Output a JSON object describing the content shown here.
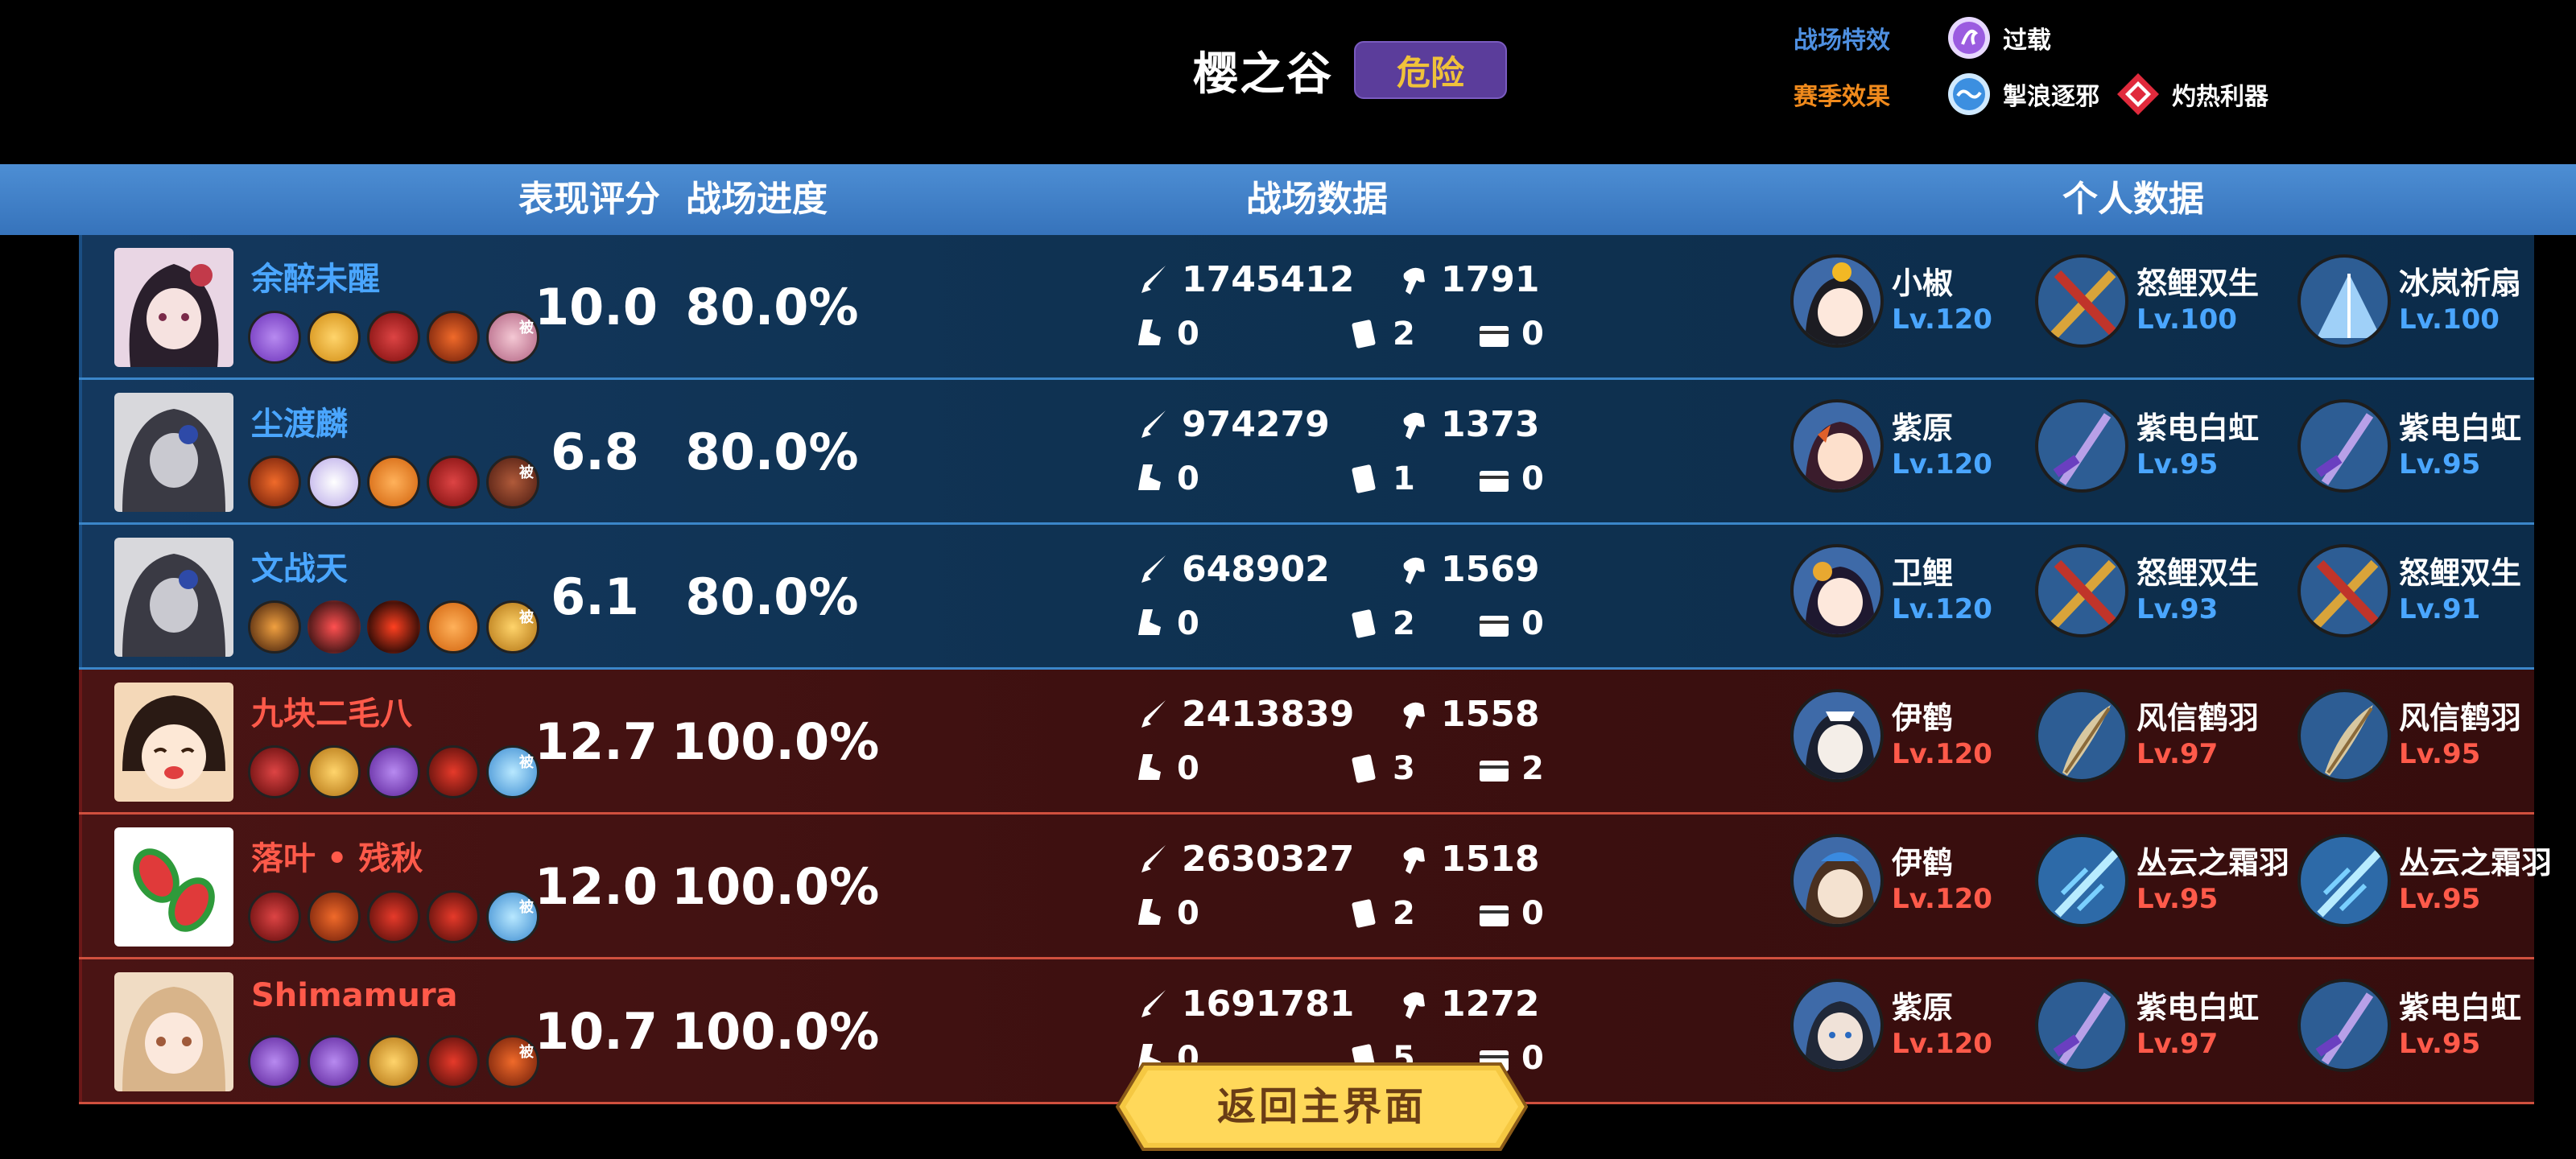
{
  "battlefield": {
    "map_name": "樱之谷",
    "danger_label": "危险"
  },
  "effects": {
    "battlefield_label": "战场特效",
    "battlefield_effect": "过载",
    "season_label": "赛季效果",
    "season_effect_1": "掣浪逐邪",
    "season_effect_2": "灼热利器",
    "colors": {
      "battlefield_label": "#4e8fe0",
      "season_label": "#f08a1c"
    }
  },
  "headers": {
    "score": "表现评分",
    "progress": "战场进度",
    "battle_data": "战场数据",
    "personal_data": "个人数据"
  },
  "team_colors": {
    "blue": "#4aa6ff",
    "red": "#ff5a4a"
  },
  "players": [
    {
      "name": "余醉未醒",
      "team": "blue",
      "score": "10.0",
      "progress": "80.0%",
      "damage": "1745412",
      "heal": "1791",
      "kills": "0",
      "cards": "2",
      "chests": "0",
      "hero": {
        "name": "小椒",
        "level": "Lv.120"
      },
      "weapon1": {
        "name": "怒鲤双生",
        "level": "Lv.100"
      },
      "weapon2": {
        "name": "冰岚祈扇",
        "level": "Lv.100"
      },
      "skill_mark": "被"
    },
    {
      "name": "尘渡麟",
      "team": "blue",
      "score": "6.8",
      "progress": "80.0%",
      "damage": "974279",
      "heal": "1373",
      "kills": "0",
      "cards": "1",
      "chests": "0",
      "hero": {
        "name": "紫原",
        "level": "Lv.120"
      },
      "weapon1": {
        "name": "紫电白虹",
        "level": "Lv.95"
      },
      "weapon2": {
        "name": "紫电白虹",
        "level": "Lv.95"
      },
      "skill_mark": "被"
    },
    {
      "name": "文战天",
      "team": "blue",
      "score": "6.1",
      "progress": "80.0%",
      "damage": "648902",
      "heal": "1569",
      "kills": "0",
      "cards": "2",
      "chests": "0",
      "hero": {
        "name": "卫鲤",
        "level": "Lv.120"
      },
      "weapon1": {
        "name": "怒鲤双生",
        "level": "Lv.93"
      },
      "weapon2": {
        "name": "怒鲤双生",
        "level": "Lv.91"
      },
      "skill_mark": "被"
    },
    {
      "name": "九块二毛八",
      "team": "red",
      "score": "12.7",
      "progress": "100.0%",
      "damage": "2413839",
      "heal": "1558",
      "kills": "0",
      "cards": "3",
      "chests": "2",
      "hero": {
        "name": "伊鹤",
        "level": "Lv.120"
      },
      "weapon1": {
        "name": "风信鹤羽",
        "level": "Lv.97"
      },
      "weapon2": {
        "name": "风信鹤羽",
        "level": "Lv.95"
      },
      "skill_mark": "被"
    },
    {
      "name": "落叶 • 残秋",
      "team": "red",
      "score": "12.0",
      "progress": "100.0%",
      "damage": "2630327",
      "heal": "1518",
      "kills": "0",
      "cards": "2",
      "chests": "0",
      "hero": {
        "name": "伊鹤",
        "level": "Lv.120"
      },
      "weapon1": {
        "name": "丛云之霜羽",
        "level": "Lv.95"
      },
      "weapon2": {
        "name": "丛云之霜羽",
        "level": "Lv.95"
      },
      "skill_mark": "被"
    },
    {
      "name": "Shimamura",
      "team": "red",
      "score": "10.7",
      "progress": "100.0%",
      "damage": "1691781",
      "heal": "1272",
      "kills": "0",
      "cards": "5",
      "chests": "0",
      "hero": {
        "name": "紫原",
        "level": "Lv.120"
      },
      "weapon1": {
        "name": "紫电白虹",
        "level": "Lv.97"
      },
      "weapon2": {
        "name": "紫电白虹",
        "level": "Lv.95"
      },
      "skill_mark": "被"
    }
  ],
  "return_button": "返回主界面"
}
